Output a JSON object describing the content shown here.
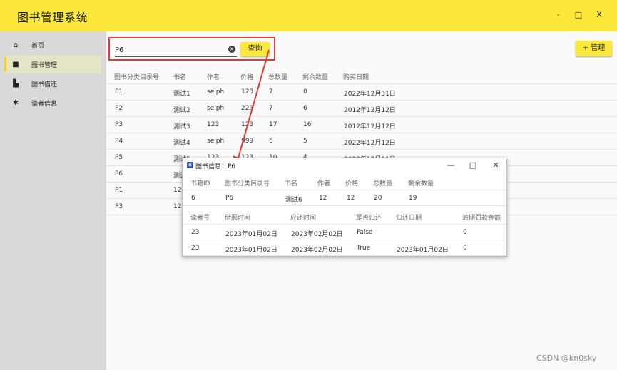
{
  "app": {
    "title": "图书管理系统",
    "window_controls": {
      "minimize": "-",
      "maximize": "□",
      "close": "X"
    }
  },
  "sidebar": {
    "items": [
      {
        "label": "首页",
        "icon": "home-icon",
        "glyph": "⌂"
      },
      {
        "label": "图书管理",
        "icon": "book-icon",
        "glyph": "■"
      },
      {
        "label": "图书借还",
        "icon": "borrow-icon",
        "glyph": "▙"
      },
      {
        "label": "读者信息",
        "icon": "gear-icon",
        "glyph": "✱"
      }
    ],
    "active_index": 1
  },
  "toolbar": {
    "search_value": "P6",
    "clear_glyph": "×",
    "query_label": "查询",
    "manage_label": "+ 管理"
  },
  "table": {
    "columns": [
      "图书分类目录号",
      "书名",
      "作者",
      "价格",
      "总数量",
      "剩余数量",
      "购买日期"
    ],
    "rows": [
      [
        "P1",
        "测试1",
        "selph",
        "123",
        "7",
        "0",
        "2022年12月31日"
      ],
      [
        "P2",
        "测试2",
        "selph",
        "223",
        "7",
        "6",
        "2012年12月12日"
      ],
      [
        "P3",
        "测试3",
        "123",
        "123",
        "17",
        "16",
        "2012年12月12日"
      ],
      [
        "P4",
        "测试4",
        "selph",
        "999",
        "6",
        "5",
        "2022年12月12日"
      ],
      [
        "P5",
        "测试5",
        "123",
        "123",
        "10",
        "4",
        "2022年12月11日"
      ],
      [
        "P6",
        "测试",
        "",
        "",
        "",
        "",
        ""
      ],
      [
        "P1",
        "12",
        "",
        "",
        "",
        "",
        ""
      ],
      [
        "P3",
        "12",
        "",
        "",
        "",
        "",
        ""
      ]
    ]
  },
  "dialog": {
    "icon_letter": "B",
    "title": "图书信息：P6",
    "controls": {
      "minimize": "—",
      "maximize": "□",
      "close": "✕"
    },
    "book_columns": [
      "书籍ID",
      "图书分类目录号",
      "书名",
      "作者",
      "价格",
      "总数量",
      "剩余数量"
    ],
    "book_row": [
      "6",
      "P6",
      "测试6",
      "12",
      "12",
      "20",
      "19"
    ],
    "record_columns": [
      "读者号",
      "借阅时间",
      "应还时间",
      "是否归还",
      "归还日期",
      "逾期罚款金额"
    ],
    "records": [
      [
        "23",
        "2023年01月02日",
        "2023年02月02日",
        "False",
        "",
        "0"
      ],
      [
        "23",
        "2023年01月02日",
        "2023年02月02日",
        "True",
        "2023年01月02日",
        "0"
      ]
    ]
  },
  "colors": {
    "accent_yellow": "#fbe83b",
    "highlight_red": "#e53935"
  },
  "watermark": "CSDN @kn0sky"
}
